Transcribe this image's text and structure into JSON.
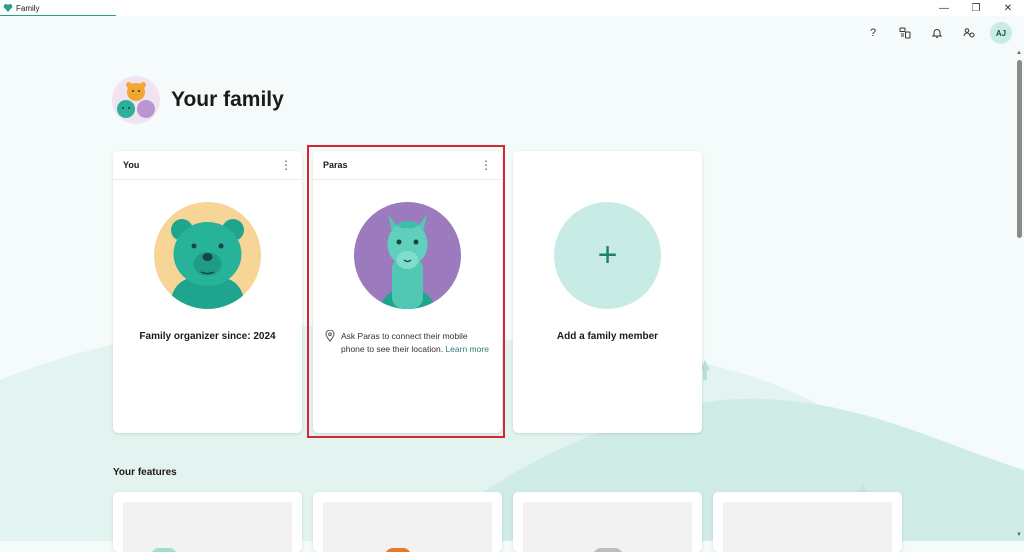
{
  "window": {
    "title": "Family"
  },
  "window_controls": {
    "minimize": "—",
    "maximize": "❐",
    "close": "✕"
  },
  "header_icons": [
    "help-icon",
    "devices-icon",
    "notifications-icon",
    "family-settings-icon"
  ],
  "header": {
    "help": "?",
    "avatar_initials": "AJ"
  },
  "page": {
    "title": "Your family"
  },
  "members": [
    {
      "name": "You",
      "caption": "Family organizer since: 2024"
    },
    {
      "name": "Paras",
      "location_text": "Ask Paras to connect their mobile phone to see their location.",
      "learn_more": "Learn more"
    }
  ],
  "add_member": {
    "label": "Add a family member",
    "icon": "+"
  },
  "features": {
    "title": "Your features"
  },
  "colors": {
    "accent": "#2b9e8e",
    "highlight": "#d62630",
    "bear_bg": "#f6d597",
    "llama_bg": "#9b7bbd",
    "add_bg": "#c8ebe6"
  }
}
